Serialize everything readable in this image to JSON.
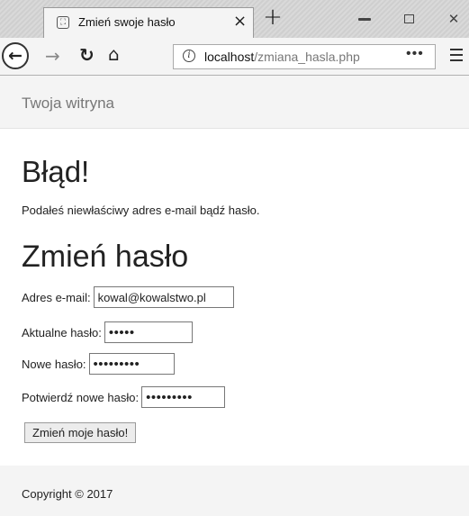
{
  "browser": {
    "tab_title": "Zmień swoje hasło",
    "tab_close": "×",
    "new_tab": "+",
    "url_host": "localhost",
    "url_path": "/zmiana_hasla.php",
    "page_actions": "•••",
    "icons": [
      "favicon-icon",
      "back-icon",
      "forward-icon",
      "reload-icon",
      "home-icon",
      "info-icon",
      "menu-icon",
      "minimize-icon",
      "maximize-icon",
      "close-window-icon"
    ]
  },
  "header": {
    "brand": "Twoja witryna"
  },
  "error": {
    "heading": "Błąd!",
    "message": "Podałeś niewłaściwy adres e-mail bądź hasło."
  },
  "form": {
    "heading": "Zmień hasło",
    "email_label": "Adres e-mail:",
    "email_value": "kowal@kowalstwo.pl",
    "current_label": "Aktualne hasło:",
    "current_value": "•••••",
    "new_label": "Nowe hasło:",
    "new_value": "•••••••••",
    "confirm_label": "Potwierdź nowe hasło:",
    "confirm_value": "•••••••••",
    "submit_label": "Zmień moje hasło!"
  },
  "footer": {
    "copyright": "Copyright © 2017"
  }
}
